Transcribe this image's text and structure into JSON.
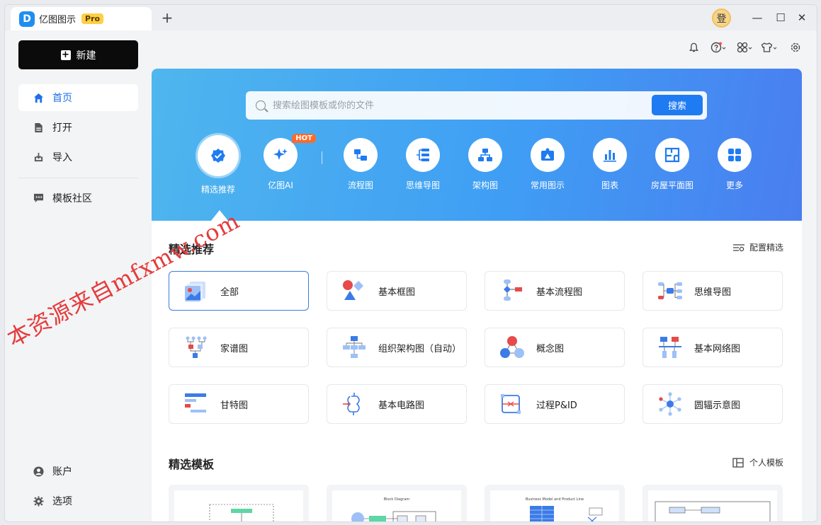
{
  "app": {
    "logo_letter": "D",
    "tab_title": "亿图图示",
    "pro_badge": "Pro",
    "new_tab": "+",
    "user_avatar": "登"
  },
  "window_controls": {
    "minimize": "—",
    "maximize": "☐",
    "close": "✕"
  },
  "sidebar": {
    "new_label": "新建",
    "nav": [
      {
        "label": "首页",
        "icon": "home-icon"
      },
      {
        "label": "打开",
        "icon": "file-icon"
      },
      {
        "label": "导入",
        "icon": "import-icon"
      },
      {
        "label": "模板社区",
        "icon": "community-icon"
      }
    ],
    "bottom": [
      {
        "label": "账户",
        "icon": "account-icon"
      },
      {
        "label": "选项",
        "icon": "settings-gear-icon"
      }
    ]
  },
  "toolbar": {
    "icons": [
      "bell-icon",
      "help-icon",
      "apps-icon",
      "skin-icon",
      "gear-icon"
    ]
  },
  "search": {
    "placeholder": "搜索绘图模板或你的文件",
    "button": "搜索"
  },
  "categories": [
    {
      "label": "精选推荐",
      "icon": "star-badge-icon",
      "active": true
    },
    {
      "label": "亿图AI",
      "icon": "sparkle-icon",
      "badge": "HOT"
    },
    {
      "label": "流程图",
      "icon": "flowchart-icon"
    },
    {
      "label": "思维导图",
      "icon": "mindmap-icon"
    },
    {
      "label": "架构图",
      "icon": "org-chart-icon"
    },
    {
      "label": "常用图示",
      "icon": "shapes-icon"
    },
    {
      "label": "图表",
      "icon": "bar-chart-icon"
    },
    {
      "label": "房屋平面图",
      "icon": "floorplan-icon"
    },
    {
      "label": "更多",
      "icon": "grid-more-icon"
    }
  ],
  "featured": {
    "title": "精选推荐",
    "config_link": "配置精选",
    "items": [
      {
        "label": "全部",
        "icon": "all-templates-icon"
      },
      {
        "label": "基本框图",
        "icon": "basic-shapes-icon"
      },
      {
        "label": "基本流程图",
        "icon": "basic-flowchart-icon"
      },
      {
        "label": "思维导图",
        "icon": "mindmap-diagram-icon"
      },
      {
        "label": "家谱图",
        "icon": "family-tree-icon"
      },
      {
        "label": "组织架构图（自动）",
        "icon": "org-auto-icon"
      },
      {
        "label": "概念图",
        "icon": "concept-map-icon"
      },
      {
        "label": "基本网络图",
        "icon": "network-icon"
      },
      {
        "label": "甘特图",
        "icon": "gantt-icon"
      },
      {
        "label": "基本电路图",
        "icon": "circuit-icon"
      },
      {
        "label": "过程P&ID",
        "icon": "pid-icon"
      },
      {
        "label": "圆辐示意图",
        "icon": "radial-icon"
      }
    ]
  },
  "templates": {
    "title": "精选模板",
    "personal_link": "个人模板",
    "cards": [
      {
        "caption": ""
      },
      {
        "caption": "Block Diagram"
      },
      {
        "caption": "Business Model and Product Line"
      },
      {
        "caption": ""
      }
    ]
  },
  "watermark": "本资源来自mfxmw.com",
  "colors": {
    "accent": "#1f7bf2",
    "hero_start": "#4fb6ee",
    "hero_end": "#4a7ef0",
    "hot": "#ff6a2a",
    "pro": "#ffcf45"
  }
}
